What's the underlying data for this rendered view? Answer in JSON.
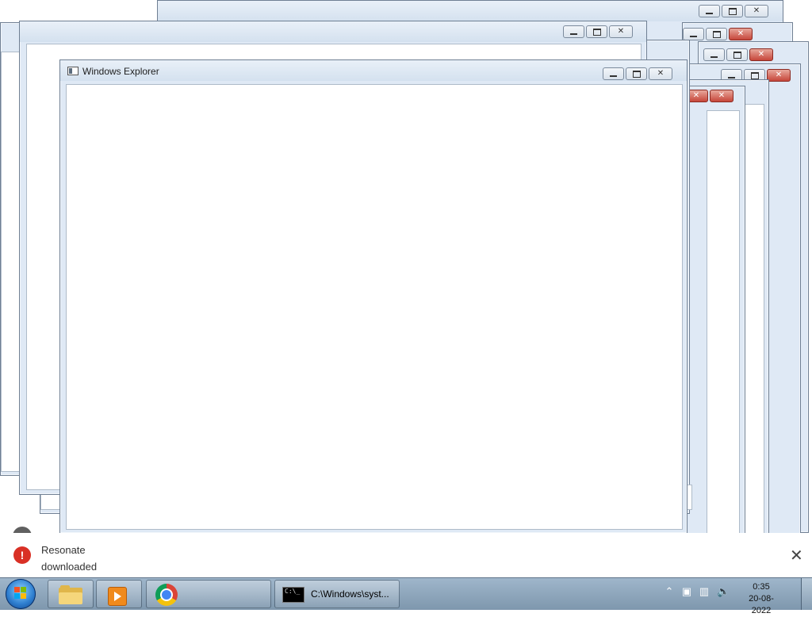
{
  "front_window": {
    "title": "Windows Explorer"
  },
  "caption_buttons": {
    "minimize_icon": "minimize-icon",
    "maximize_icon": "maximize-icon",
    "close_icon": "close-icon",
    "close_glyph": "✕"
  },
  "notification": {
    "line1": "Resonate",
    "line2": "downloaded",
    "error_glyph": "!",
    "close_glyph": "✕"
  },
  "taskbar": {
    "pinned": [
      "windows-explorer-icon",
      "media-player-icon",
      "chrome-icon"
    ],
    "cmd_label": "C:\\Windows\\syst...",
    "cmd_icon_text": "C:\\_",
    "clock_time": "0:35",
    "clock_date": "20-08-2022"
  },
  "colors": {
    "taskbar": "#8aa3b9",
    "window_frame": "#dfe9f5",
    "close_red": "#c6463a",
    "error_red": "#d93025"
  }
}
